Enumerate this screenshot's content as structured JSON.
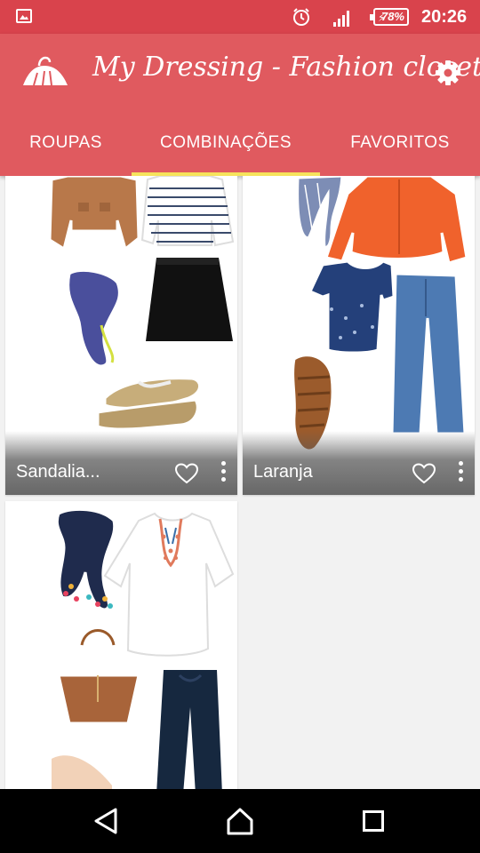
{
  "status_bar": {
    "battery_percent": "78%",
    "time": "20:26",
    "icons": [
      "image-icon",
      "alarm-icon",
      "signal-icon",
      "battery-icon"
    ]
  },
  "app_bar": {
    "title": "My Dressing - Fashion closet",
    "settings_icon": "gear-icon",
    "background_color": "#e05a5f",
    "status_color": "#d9434c",
    "indicator_color": "#f6e35c"
  },
  "tabs": [
    {
      "label": "ROUPAS",
      "selected": false
    },
    {
      "label": "COMBINAÇÕES",
      "selected": true
    },
    {
      "label": "FAVORITOS",
      "selected": false
    }
  ],
  "outfits": [
    {
      "name": "Sandalia...",
      "favorite_icon": "heart-outline-icon",
      "menu_icon": "more-vert-icon"
    },
    {
      "name": "Laranja",
      "favorite_icon": "heart-outline-icon",
      "menu_icon": "more-vert-icon"
    },
    {
      "name": "",
      "favorite_icon": "",
      "menu_icon": ""
    }
  ],
  "nav_bar": {
    "icons": [
      "back-icon",
      "home-icon",
      "recent-apps-icon"
    ]
  }
}
